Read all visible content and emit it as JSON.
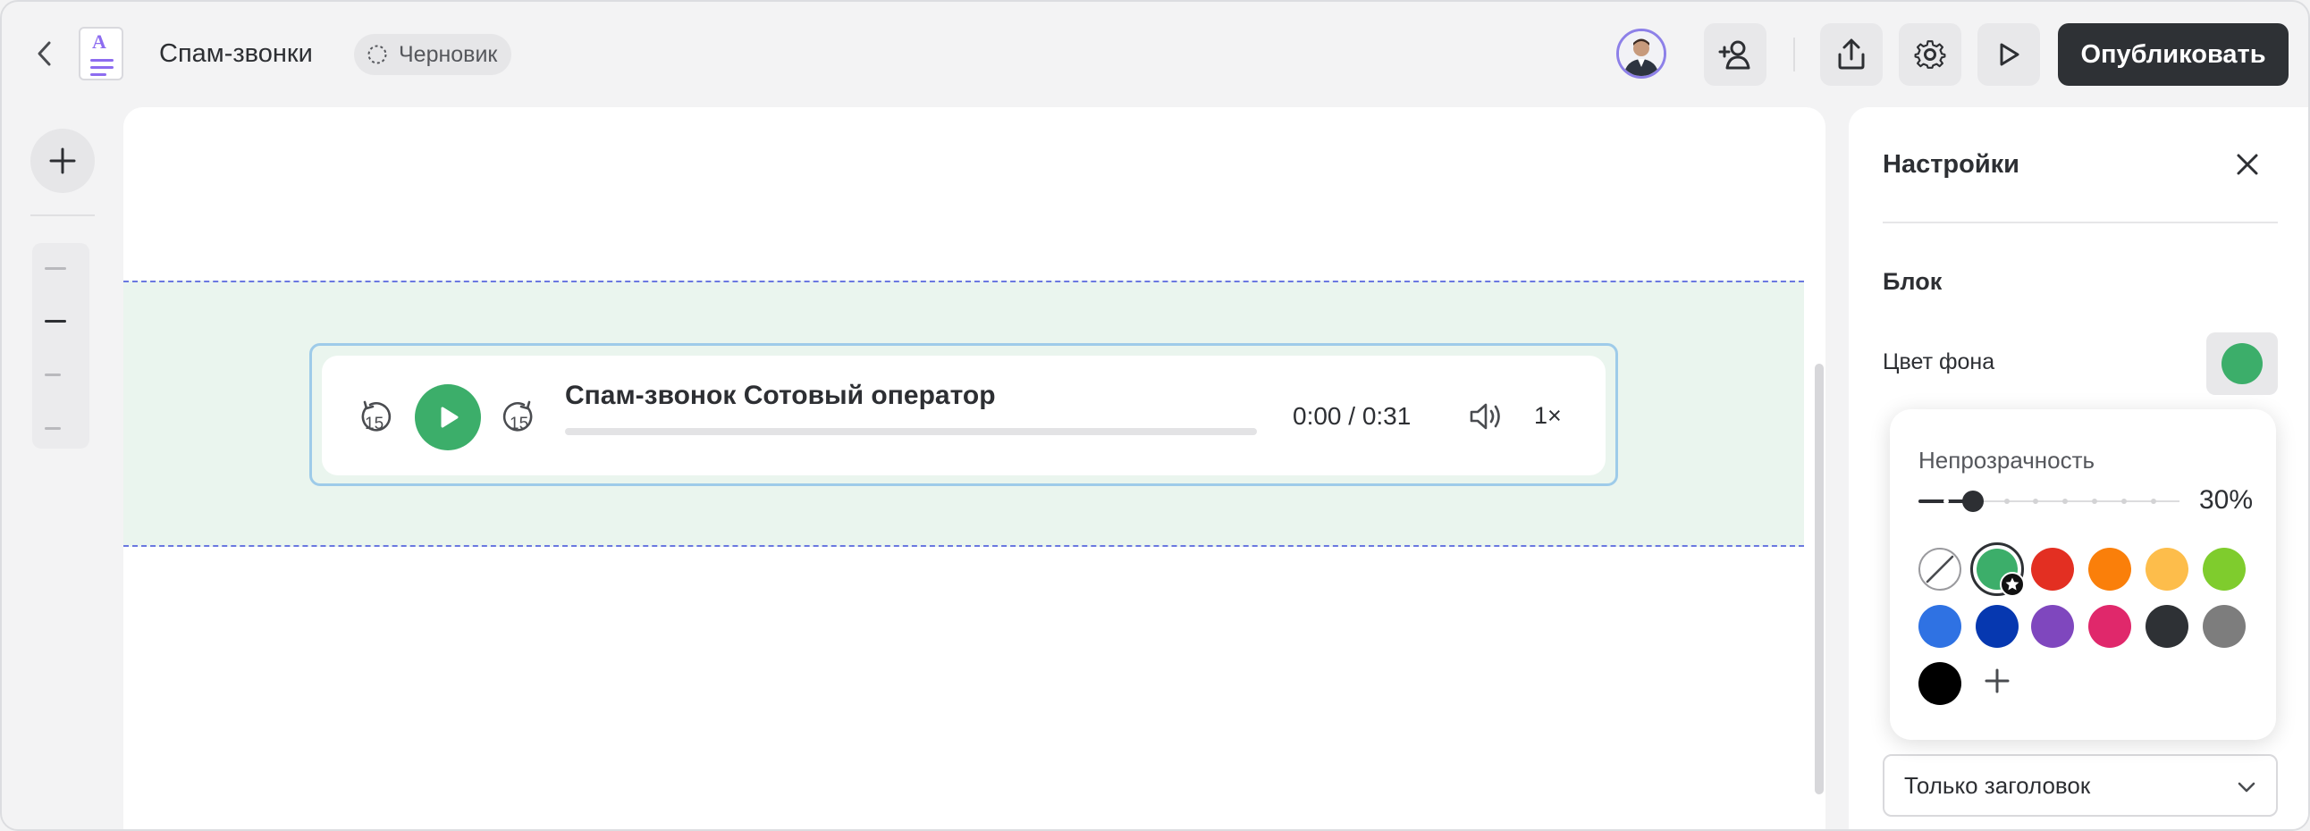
{
  "header": {
    "title": "Спам-звонки",
    "status_badge": "Черновик",
    "publish_label": "Опубликовать",
    "doc_icon_letter": "A"
  },
  "player": {
    "title": "Спам-звонок Сотовый оператор",
    "time": "0:00 / 0:31",
    "speed": "1×",
    "skip_back": "15",
    "skip_forward": "15",
    "progress": 0
  },
  "settings": {
    "title": "Настройки",
    "section": "Блок",
    "bg_color_label": "Цвет фона",
    "dropdown_value": "Только заголовок"
  },
  "color_popover": {
    "opacity_label": "Непрозрачность",
    "opacity_value": "30%",
    "opacity_fraction": 0.3,
    "selected_color": "#3cae6a",
    "colors": [
      "none",
      "#3cae6a",
      "#e32f22",
      "#fa7f0a",
      "#fdbd4b",
      "#7fcc2d",
      "#2f72e3",
      "#0638b0",
      "#7f47be",
      "#e0286b",
      "#2e3135",
      "#7d7d7d",
      "#000000"
    ]
  }
}
